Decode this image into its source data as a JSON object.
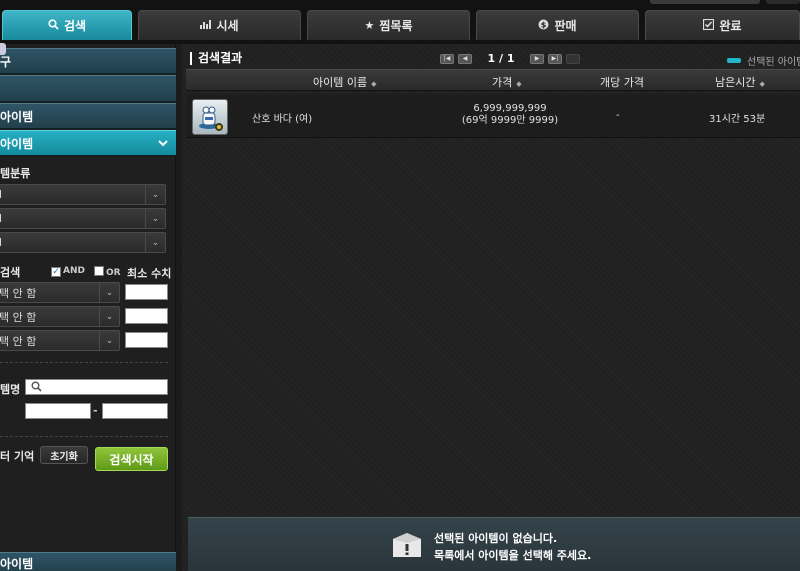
{
  "tabs": [
    {
      "icon": "search-icon",
      "glyph": "🔍",
      "label": "검색"
    },
    {
      "icon": "chart-icon",
      "glyph": "▟",
      "label": "시세"
    },
    {
      "icon": "star-icon",
      "glyph": "★",
      "label": "찜목록"
    },
    {
      "icon": "coin-icon",
      "glyph": "$",
      "label": "판매"
    },
    {
      "icon": "check-icon",
      "glyph": "☑",
      "label": "완료"
    }
  ],
  "sidebar": {
    "head1": "구",
    "head3": "아이템",
    "head4": "아이템",
    "category_label": "템분류",
    "category_selects": [
      "l",
      "l",
      "l"
    ],
    "option_label": "검색",
    "and_label": "AND",
    "or_label": "OR",
    "min_label": "최소 수치",
    "option_selects": [
      "택 안 함",
      "택 안 함",
      "택 안 함"
    ],
    "name_label": "템명",
    "range_sep": "-",
    "filter_remember": "터 기억",
    "reset_label": "초기화",
    "search_label": "검색시작",
    "bottom_head": "아이템"
  },
  "results": {
    "title": "검색결과",
    "page_count": "1 / 1",
    "legend_label": "선택된 아이템",
    "columns": [
      "아이템 이름",
      "가격",
      "개당 가격",
      "남은시간"
    ],
    "rows": [
      {
        "name": "산호 바다 (여)",
        "price": "6,999,999,999",
        "price_korean": "(69억 9999만 9999)",
        "unit_price": "-",
        "time_left": "31시간 53분"
      }
    ]
  },
  "empty_panel": {
    "line1": "선택된 아이템이 없습니다.",
    "line2": "목록에서 아이템을 선택해 주세요."
  }
}
